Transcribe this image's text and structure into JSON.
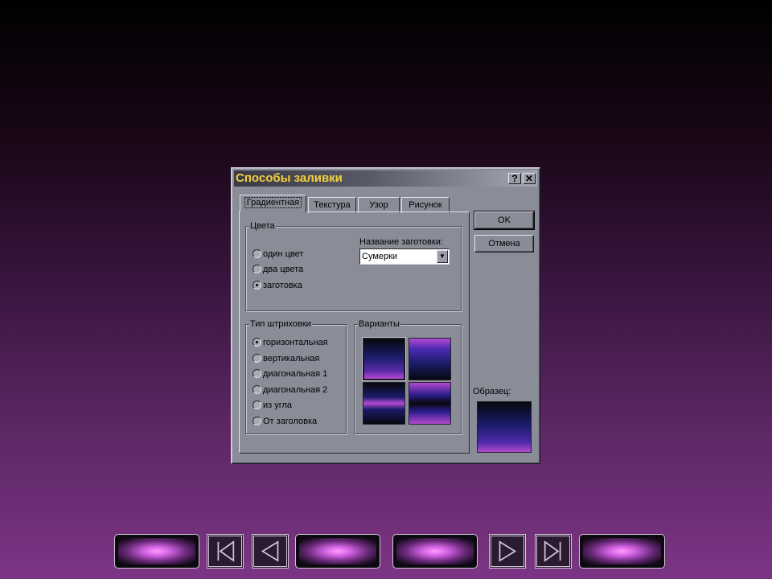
{
  "dialog": {
    "title": "Способы заливки",
    "help_button": "?",
    "close_button": "✕",
    "tabs": [
      {
        "label": "Градиентная",
        "active": true
      },
      {
        "label": "Текстура",
        "active": false
      },
      {
        "label": "Узор",
        "active": false
      },
      {
        "label": "Рисунок",
        "active": false
      }
    ],
    "colors_group": {
      "label": "Цвета",
      "options": [
        {
          "label": "один цвет",
          "selected": false
        },
        {
          "label": "два цвета",
          "selected": false
        },
        {
          "label": "заготовка",
          "selected": true
        }
      ],
      "preset_name_label": "Название заготовки:",
      "preset_value": "Сумерки"
    },
    "shading_group": {
      "label": "Тип штриховки",
      "options": [
        {
          "label": "горизонтальная",
          "selected": true
        },
        {
          "label": "вертикальная",
          "selected": false
        },
        {
          "label": "диагональная 1",
          "selected": false
        },
        {
          "label": "диагональная 2",
          "selected": false
        },
        {
          "label": "из угла",
          "selected": false
        },
        {
          "label": "От заголовка",
          "selected": false
        }
      ]
    },
    "variants_group": {
      "label": "Варианты",
      "selected_index": 0
    },
    "buttons": {
      "ok": "OK",
      "cancel": "Отмена"
    },
    "sample_label": "Образец:"
  },
  "colors": {
    "title_text": "#f2d040",
    "dialog_face": "#8a8c98",
    "gradient_dark": "#08080e",
    "gradient_blue": "#1a1c6a",
    "gradient_violet": "#b44ad0"
  },
  "navigation": {
    "buttons": [
      "blank-button",
      "first-slide-icon",
      "previous-slide-icon",
      "blank-button",
      "blank-button",
      "next-slide-icon",
      "last-slide-icon",
      "blank-button"
    ]
  }
}
